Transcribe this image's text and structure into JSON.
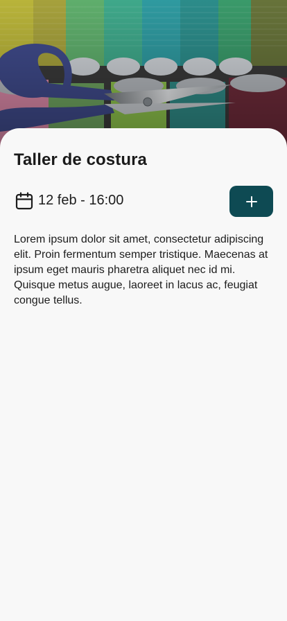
{
  "hero": {
    "image_description": "",
    "icon": "scissors-on-thread-spools-image"
  },
  "event": {
    "title": "Taller de costura",
    "datetime": "12 feb - 16:00",
    "description": "Lorem ipsum dolor sit amet, consectetur adipiscing elit. Proin fermentum semper tristique. Maecenas at ipsum eget mauris pharetra aliquet nec id mi. Quisque metus augue, laoreet in lacus ac, feugiat congue tellus."
  },
  "icons": {
    "calendar": "calendar-icon",
    "add": "plus-icon"
  },
  "colors": {
    "accent": "#0e4a53",
    "background": "#f8f8f8",
    "text": "#1c1c1c"
  }
}
